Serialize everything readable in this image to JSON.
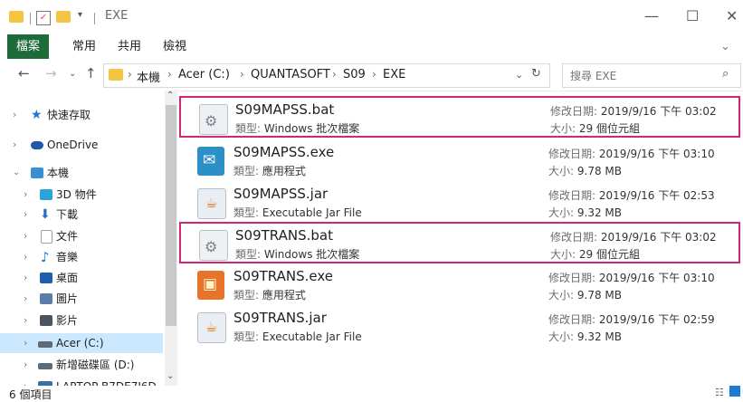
{
  "window": {
    "title": "EXE",
    "minimize": "—",
    "maximize": "☐",
    "close": "✕"
  },
  "ribbon": {
    "tabs": [
      "檔案",
      "常用",
      "共用",
      "檢視"
    ],
    "help_chevron": "⌄"
  },
  "address": {
    "crumbs": [
      "本機",
      "Acer (C:)",
      "QUANTASOFT",
      "S09",
      "EXE"
    ],
    "separator": "›",
    "search_placeholder": "搜尋 EXE"
  },
  "nav": {
    "items": [
      {
        "label": "快速存取",
        "icon": "star-icon",
        "color": "#1f78d1"
      },
      {
        "label": "OneDrive",
        "icon": "cloud-icon",
        "color": "#1e5aa8"
      },
      {
        "label": "本機",
        "icon": "computer-icon",
        "color": "#3a8ed6"
      },
      {
        "label": "3D 物件",
        "icon": "cube-icon",
        "color": "#2aa3d8"
      },
      {
        "label": "下載",
        "icon": "download-arrow-icon",
        "color": "#2b6fbe"
      },
      {
        "label": "文件",
        "icon": "document-icon",
        "color": "#9aa3ad"
      },
      {
        "label": "音樂",
        "icon": "music-note-icon",
        "color": "#1e7bd6"
      },
      {
        "label": "桌面",
        "icon": "desktop-icon",
        "color": "#1e5fb0"
      },
      {
        "label": "圖片",
        "icon": "pictures-icon",
        "color": "#5a7ea8"
      },
      {
        "label": "影片",
        "icon": "video-icon",
        "color": "#4a5561"
      },
      {
        "label": "Acer (C:)",
        "icon": "drive-icon",
        "color": "#5d6a78"
      },
      {
        "label": "新增磁碟區 (D:)",
        "icon": "drive-icon",
        "color": "#5d6a78"
      },
      {
        "label": "LAPTOP-B7DE7I6D",
        "icon": "network-pc-icon",
        "color": "#3a6fa8"
      }
    ]
  },
  "files": [
    {
      "name": "S09MAPSS.bat",
      "type_key": "類型:",
      "type": "Windows 批次檔案",
      "date_key": "修改日期:",
      "date": "2019/9/16 下午 03:02",
      "size_key": "大小:",
      "size": "29 個位元組",
      "icon": "batch-gear-icon",
      "color": "#9aa2ab",
      "highlighted": true
    },
    {
      "name": "S09MAPSS.exe",
      "type_key": "類型:",
      "type": "應用程式",
      "date_key": "修改日期:",
      "date": "2019/9/16 下午 03:10",
      "size_key": "大小:",
      "size": "9.78 MB",
      "icon": "app-exe-icon",
      "color": "#2d8fc8",
      "highlighted": false
    },
    {
      "name": "S09MAPSS.jar",
      "type_key": "類型:",
      "type": "Executable Jar File",
      "date_key": "修改日期:",
      "date": "2019/9/16 下午 02:53",
      "size_key": "大小:",
      "size": "9.32 MB",
      "icon": "java-jar-icon",
      "color": "#e8eef4",
      "highlighted": false
    },
    {
      "name": "S09TRANS.bat",
      "type_key": "類型:",
      "type": "Windows 批次檔案",
      "date_key": "修改日期:",
      "date": "2019/9/16 下午 03:02",
      "size_key": "大小:",
      "size": "29 個位元組",
      "icon": "batch-gear-icon",
      "color": "#9aa2ab",
      "highlighted": true
    },
    {
      "name": "S09TRANS.exe",
      "type_key": "類型:",
      "type": "應用程式",
      "date_key": "修改日期:",
      "date": "2019/9/16 下午 03:10",
      "size_key": "大小:",
      "size": "9.78 MB",
      "icon": "app-exe-icon",
      "color": "#e8732b",
      "highlighted": false
    },
    {
      "name": "S09TRANS.jar",
      "type_key": "類型:",
      "type": "Executable Jar File",
      "date_key": "修改日期:",
      "date": "2019/9/16 下午 02:59",
      "size_key": "大小:",
      "size": "9.32 MB",
      "icon": "java-jar-icon",
      "color": "#e8eef4",
      "highlighted": false
    }
  ],
  "status": {
    "count": "6 個項目"
  }
}
